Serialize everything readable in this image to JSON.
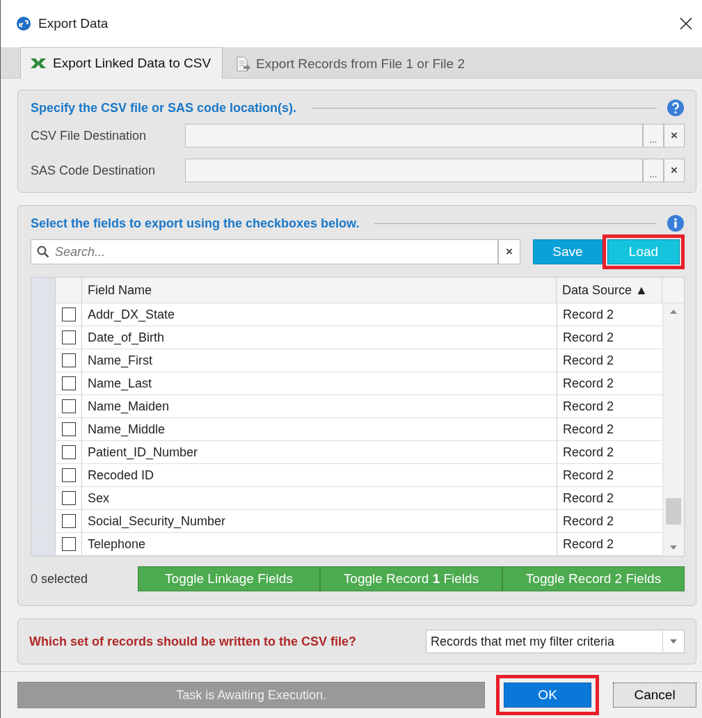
{
  "window": {
    "title": "Export Data"
  },
  "tabs": [
    {
      "label": "Export Linked Data to CSV",
      "selected": true,
      "kind": "excel"
    },
    {
      "label": "Export Records from File 1 or File 2",
      "selected": false,
      "kind": "document"
    }
  ],
  "location_panel": {
    "heading": "Specify the CSV file or SAS code location(s).",
    "fields": [
      {
        "label": "CSV File Destination",
        "browse": "...",
        "clear": "×"
      },
      {
        "label": "SAS Code Destination",
        "browse": "...",
        "clear": "×"
      }
    ]
  },
  "fields_panel": {
    "heading": "Select the fields to export using the checkboxes below.",
    "search": {
      "placeholder": "Search...",
      "clear": "×"
    },
    "buttons": [
      {
        "label": "Save",
        "highlighted": false
      },
      {
        "label": "Load",
        "highlighted": true
      }
    ],
    "table": {
      "columns": [
        "Field Name",
        "Data Source ▲"
      ],
      "rows": [
        {
          "field": "Addr_DX_State",
          "source": "Record 2",
          "checked": false
        },
        {
          "field": "Date_of_Birth",
          "source": "Record 2",
          "checked": false
        },
        {
          "field": "Name_First",
          "source": "Record 2",
          "checked": false
        },
        {
          "field": "Name_Last",
          "source": "Record 2",
          "checked": false
        },
        {
          "field": "Name_Maiden",
          "source": "Record 2",
          "checked": false
        },
        {
          "field": "Name_Middle",
          "source": "Record 2",
          "checked": false
        },
        {
          "field": "Patient_ID_Number",
          "source": "Record 2",
          "checked": false
        },
        {
          "field": "Recoded ID",
          "source": "Record 2",
          "checked": false
        },
        {
          "field": "Sex",
          "source": "Record 2",
          "checked": false
        },
        {
          "field": "Social_Security_Number",
          "source": "Record 2",
          "checked": false
        },
        {
          "field": "Telephone",
          "source": "Record 2",
          "checked": false
        }
      ]
    },
    "selected_count": "0 selected",
    "toggles": [
      "Toggle Linkage Fields",
      "Toggle Record **1** Fields",
      "Toggle Record 2 Fields"
    ]
  },
  "records_panel": {
    "question": "Which set of records should be written to the CSV file?",
    "dropdown": "Records that met my filter criteria"
  },
  "footer": {
    "status": "Task is Awaiting Execution.",
    "buttons": [
      {
        "label": "OK",
        "kind": "primary",
        "highlighted": true
      },
      {
        "label": "Cancel",
        "kind": "secondary",
        "highlighted": false
      }
    ]
  }
}
